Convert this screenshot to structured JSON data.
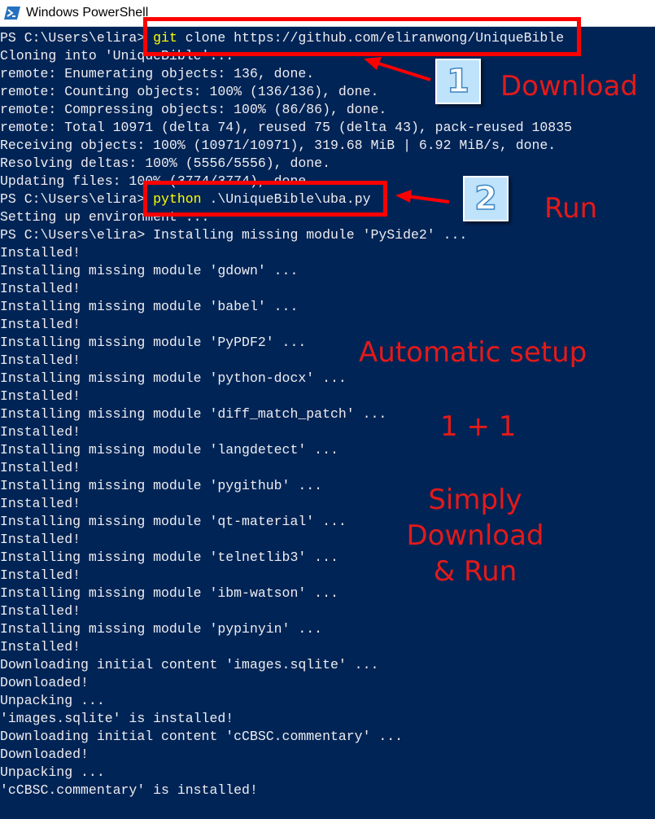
{
  "window": {
    "title": "Windows PowerShell",
    "icon": "powershell-icon"
  },
  "console": {
    "lines": [
      [
        {
          "t": "PS C:\\Users\\elira> "
        },
        {
          "t": "git",
          "c": "yellow"
        },
        {
          "t": " clone https://github.com/eliranwong/UniqueBible"
        }
      ],
      [
        {
          "t": "Cloning into 'UniqueBible'..."
        }
      ],
      [
        {
          "t": "remote: Enumerating objects: 136, done."
        }
      ],
      [
        {
          "t": "remote: Counting objects: 100% (136/136), done."
        }
      ],
      [
        {
          "t": "remote: Compressing objects: 100% (86/86), done."
        }
      ],
      [
        {
          "t": "remote: Total 10971 (delta 74), reused 75 (delta 43), pack-reused 10835"
        }
      ],
      [
        {
          "t": "Receiving objects: 100% (10971/10971), 319.68 MiB | 6.92 MiB/s, done."
        }
      ],
      [
        {
          "t": "Resolving deltas: 100% (5556/5556), done."
        }
      ],
      [
        {
          "t": "Updating files: 100% (3774/3774), done."
        }
      ],
      [
        {
          "t": "PS C:\\Users\\elira> "
        },
        {
          "t": "python",
          "c": "yellow"
        },
        {
          "t": " .\\UniqueBible\\uba.py"
        }
      ],
      [
        {
          "t": "Setting up environment ..."
        }
      ],
      [
        {
          "t": "PS C:\\Users\\elira> Installing missing module 'PySide2' ..."
        }
      ],
      [
        {
          "t": "Installed!"
        }
      ],
      [
        {
          "t": "Installing missing module 'gdown' ..."
        }
      ],
      [
        {
          "t": "Installed!"
        }
      ],
      [
        {
          "t": "Installing missing module 'babel' ..."
        }
      ],
      [
        {
          "t": "Installed!"
        }
      ],
      [
        {
          "t": "Installing missing module 'PyPDF2' ..."
        }
      ],
      [
        {
          "t": "Installed!"
        }
      ],
      [
        {
          "t": "Installing missing module 'python-docx' ..."
        }
      ],
      [
        {
          "t": "Installed!"
        }
      ],
      [
        {
          "t": "Installing missing module 'diff_match_patch' ..."
        }
      ],
      [
        {
          "t": "Installed!"
        }
      ],
      [
        {
          "t": "Installing missing module 'langdetect' ..."
        }
      ],
      [
        {
          "t": "Installed!"
        }
      ],
      [
        {
          "t": "Installing missing module 'pygithub' ..."
        }
      ],
      [
        {
          "t": "Installed!"
        }
      ],
      [
        {
          "t": "Installing missing module 'qt-material' ..."
        }
      ],
      [
        {
          "t": "Installed!"
        }
      ],
      [
        {
          "t": "Installing missing module 'telnetlib3' ..."
        }
      ],
      [
        {
          "t": "Installed!"
        }
      ],
      [
        {
          "t": "Installing missing module 'ibm-watson' ..."
        }
      ],
      [
        {
          "t": "Installed!"
        }
      ],
      [
        {
          "t": "Installing missing module 'pypinyin' ..."
        }
      ],
      [
        {
          "t": "Installed!"
        }
      ],
      [
        {
          "t": "Downloading initial content 'images.sqlite' ..."
        }
      ],
      [
        {
          "t": "Downloaded!"
        }
      ],
      [
        {
          "t": "Unpacking ..."
        }
      ],
      [
        {
          "t": "'images.sqlite' is installed!"
        }
      ],
      [
        {
          "t": "Downloading initial content 'cCBSC.commentary' ..."
        }
      ],
      [
        {
          "t": "Downloaded!"
        }
      ],
      [
        {
          "t": "Unpacking ..."
        }
      ],
      [
        {
          "t": "'cCBSC.commentary' is installed!"
        }
      ]
    ],
    "text_color": "#eeedf0",
    "command_color": "#ffff00",
    "background": "#012456"
  },
  "annotations": {
    "step1_number": "1",
    "step1_label": "Download",
    "step2_number": "2",
    "step2_label": "Run",
    "automatic_setup": "Automatic setup",
    "one_plus_one": "1 + 1",
    "simply_lines": [
      "Simply",
      "Download",
      "& Run"
    ],
    "color": "#e31a1a"
  }
}
